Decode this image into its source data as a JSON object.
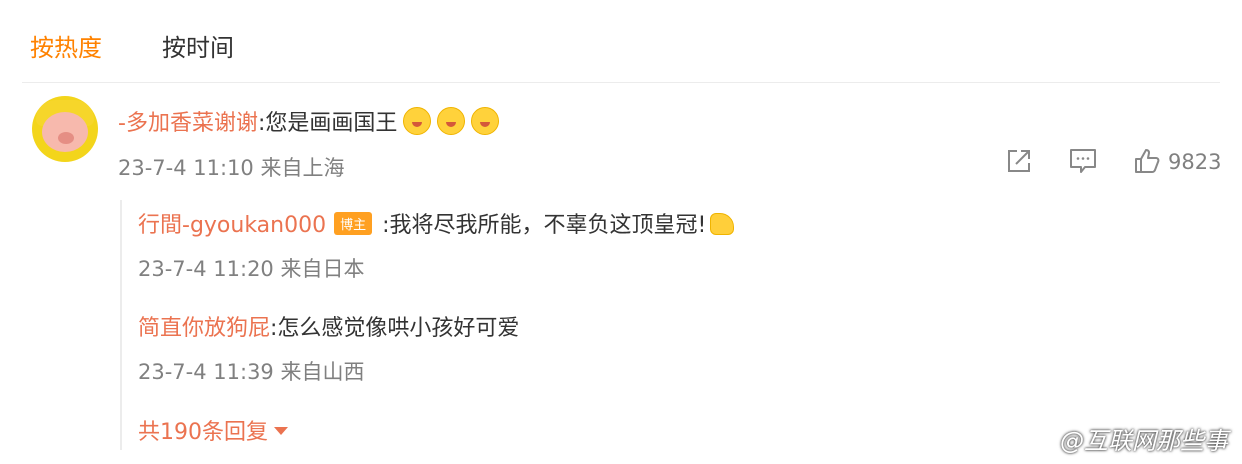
{
  "tabs": {
    "hot": "按热度",
    "time": "按时间"
  },
  "comment": {
    "username": "-多加香菜谢谢",
    "text": ":您是画画国王",
    "meta": "23-7-4 11:10 来自上海",
    "like_count": "9823"
  },
  "replies": [
    {
      "username": "行間-gyoukan000",
      "badge": "博主",
      "text": ":我将尽我所能，不辜负这顶皇冠!",
      "meta": "23-7-4 11:20 来自日本"
    },
    {
      "username": "简直你放狗屁",
      "text": ":怎么感觉像哄小孩好可爱",
      "meta": "23-7-4 11:39 来自山西"
    }
  ],
  "more_replies": "共190条回复",
  "watermark": "@互联网那些事",
  "icons": [
    "share-icon",
    "comment-icon",
    "like-icon",
    "caret-down-icon",
    "kiss-emoji-icon",
    "muscle-emoji-icon"
  ],
  "colors": {
    "accent": "#ff8200",
    "username": "#eb7350",
    "meta": "#808080"
  }
}
